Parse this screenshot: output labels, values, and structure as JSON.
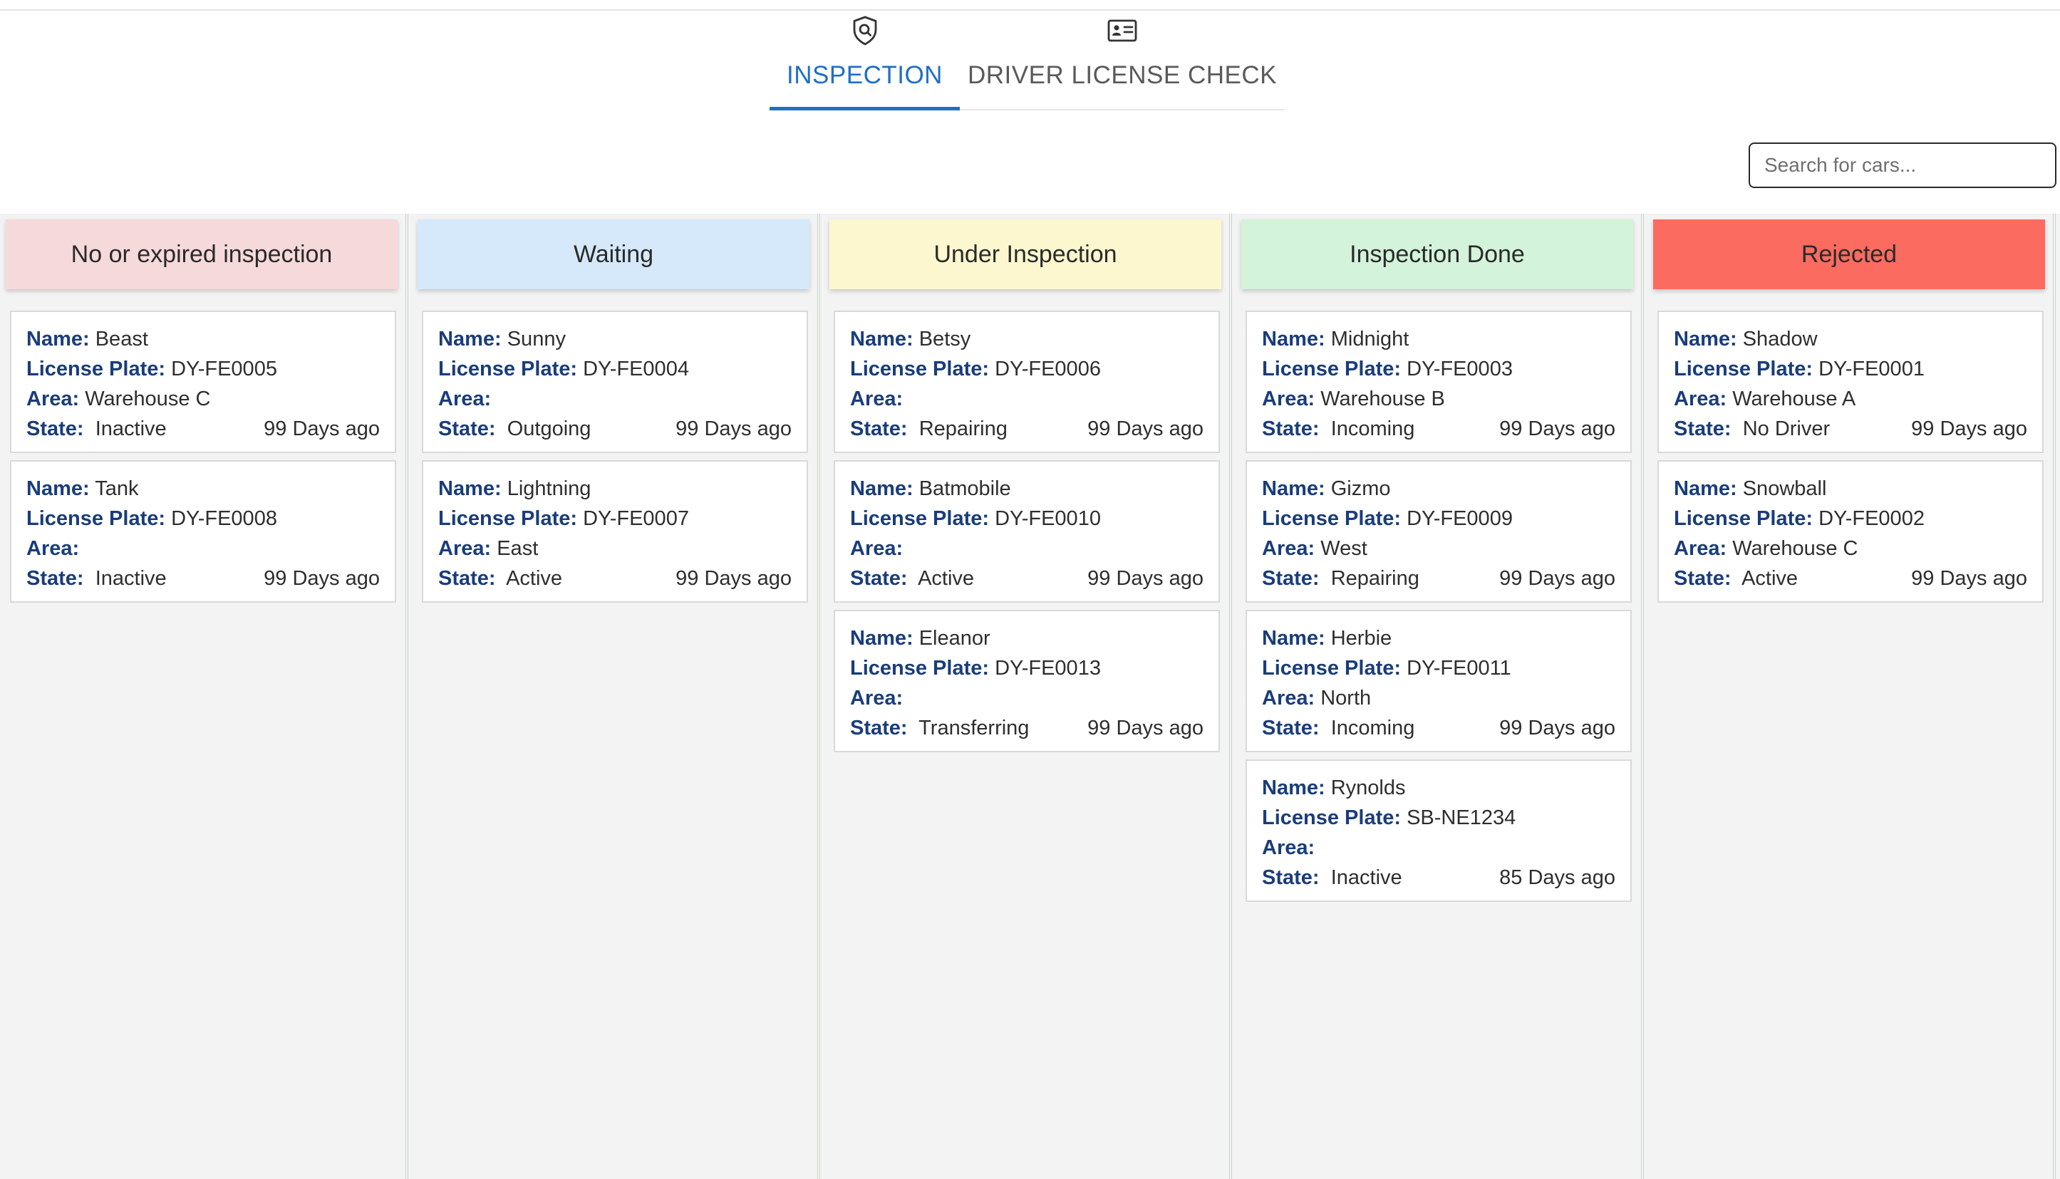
{
  "tabs": [
    {
      "label": "INSPECTION",
      "icon": "shield-search-icon",
      "active": true
    },
    {
      "label": "DRIVER LICENSE CHECK",
      "icon": "id-card-icon",
      "active": false
    }
  ],
  "search": {
    "placeholder": "Search for cars..."
  },
  "labels": {
    "name": "Name:",
    "plate": "License Plate:",
    "area": "Area:",
    "state": "State:"
  },
  "columns": [
    {
      "title": "No or expired inspection",
      "color": "#f6d9db",
      "cards": [
        {
          "name": "Beast",
          "plate": "DY-FE0005",
          "area": "Warehouse C",
          "state": "Inactive",
          "ago": "99 Days ago"
        },
        {
          "name": "Tank",
          "plate": "DY-FE0008",
          "area": "",
          "state": "Inactive",
          "ago": "99 Days ago"
        }
      ]
    },
    {
      "title": "Waiting",
      "color": "#d6e9fb",
      "cards": [
        {
          "name": "Sunny",
          "plate": "DY-FE0004",
          "area": "",
          "state": "Outgoing",
          "ago": "99 Days ago"
        },
        {
          "name": "Lightning",
          "plate": "DY-FE0007",
          "area": "East",
          "state": "Active",
          "ago": "99 Days ago"
        }
      ]
    },
    {
      "title": "Under Inspection",
      "color": "#fdf7cf",
      "cards": [
        {
          "name": "Betsy",
          "plate": "DY-FE0006",
          "area": "",
          "state": "Repairing",
          "ago": "99 Days ago"
        },
        {
          "name": "Batmobile",
          "plate": "DY-FE0010",
          "area": "",
          "state": "Active",
          "ago": "99 Days ago"
        },
        {
          "name": "Eleanor",
          "plate": "DY-FE0013",
          "area": "",
          "state": "Transferring",
          "ago": "99 Days ago"
        }
      ]
    },
    {
      "title": "Inspection Done",
      "color": "#d3f3da",
      "cards": [
        {
          "name": "Midnight",
          "plate": "DY-FE0003",
          "area": "Warehouse B",
          "state": "Incoming",
          "ago": "99 Days ago"
        },
        {
          "name": "Gizmo",
          "plate": "DY-FE0009",
          "area": "West",
          "state": "Repairing",
          "ago": "99 Days ago"
        },
        {
          "name": "Herbie",
          "plate": "DY-FE0011",
          "area": "North",
          "state": "Incoming",
          "ago": "99 Days ago"
        },
        {
          "name": "Rynolds",
          "plate": "SB-NE1234",
          "area": "",
          "state": "Inactive",
          "ago": "85 Days ago"
        }
      ]
    },
    {
      "title": "Rejected",
      "color": "#fc6b60",
      "cards": [
        {
          "name": "Shadow",
          "plate": "DY-FE0001",
          "area": "Warehouse A",
          "state": "No Driver",
          "ago": "99 Days ago"
        },
        {
          "name": "Snowball",
          "plate": "DY-FE0002",
          "area": "Warehouse C",
          "state": "Active",
          "ago": "99 Days ago"
        }
      ]
    }
  ]
}
